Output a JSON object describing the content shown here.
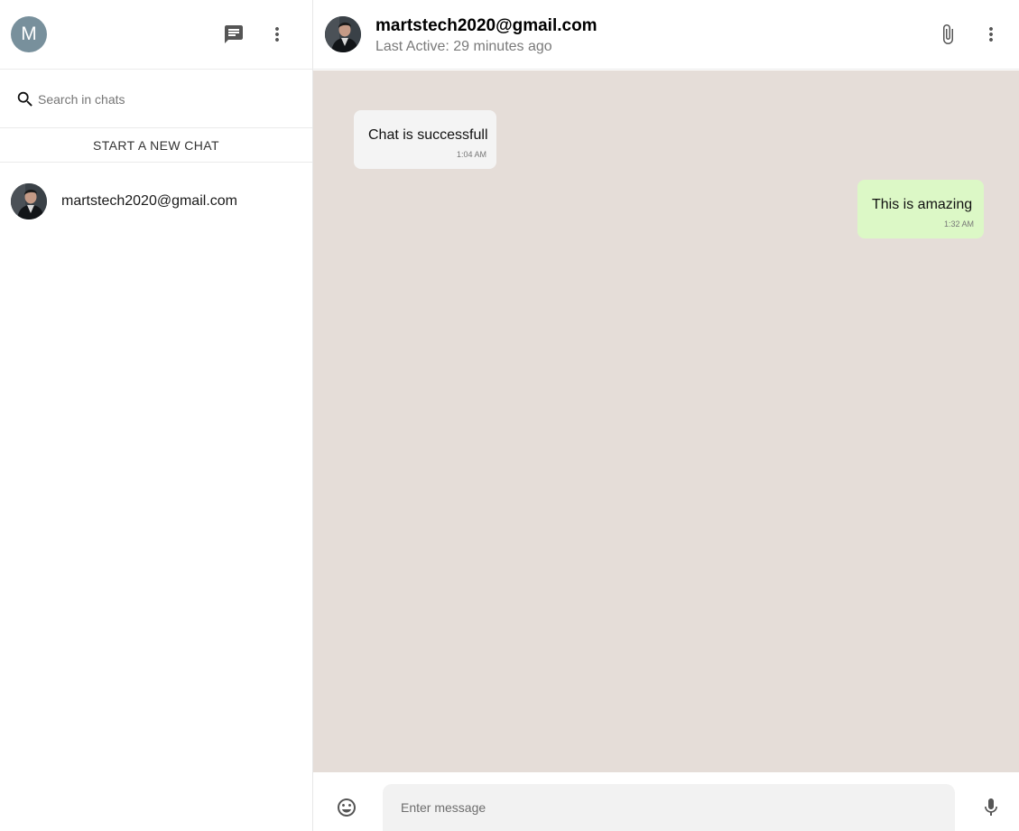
{
  "sidebar": {
    "user_initial": "M",
    "search_placeholder": "Search in chats",
    "start_chat_label": "START A NEW CHAT",
    "chats": [
      {
        "name": "martstech2020@gmail.com"
      }
    ]
  },
  "chat": {
    "contact_name": "martstech2020@gmail.com",
    "status": "Last Active: 29 minutes ago",
    "messages": [
      {
        "text": "Chat is successfull",
        "time": "1:04 AM",
        "direction": "incoming"
      },
      {
        "text": "This is amazing",
        "time": "1:32 AM",
        "direction": "outgoing"
      }
    ],
    "input_placeholder": "Enter message"
  },
  "icons": {
    "new_chat": "chat-icon",
    "more": "more-vert-icon",
    "search": "search-icon",
    "attach": "paperclip-icon",
    "emoji": "emoji-icon",
    "mic": "mic-icon"
  },
  "colors": {
    "avatar_bg": "#78909c",
    "chat_background": "#e5ddd8",
    "incoming_bubble": "#f4f4f4",
    "outgoing_bubble": "#dcf8c6"
  }
}
